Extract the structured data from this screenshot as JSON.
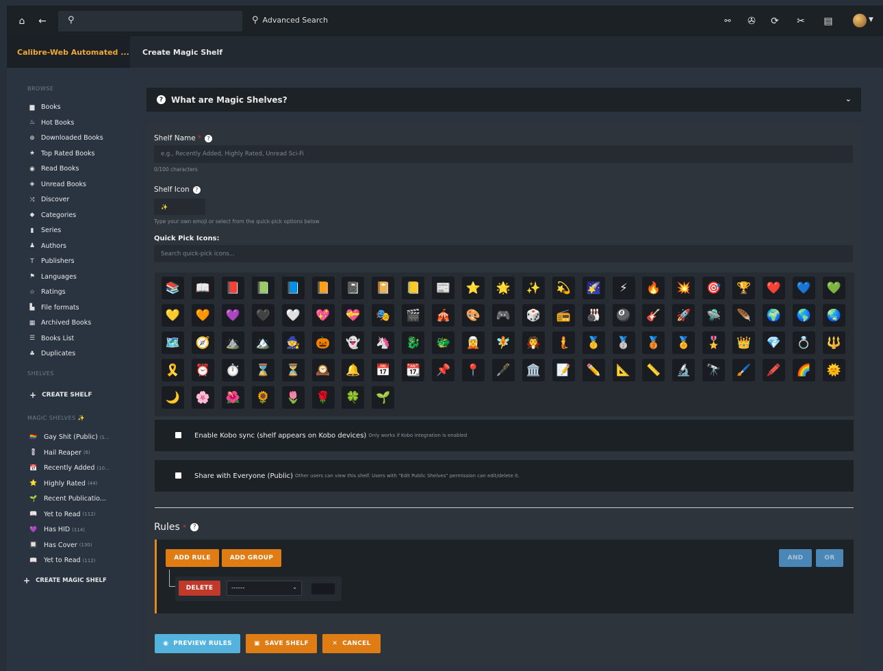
{
  "topbar": {
    "search_placeholder": "",
    "advanced_search": "Advanced Search"
  },
  "sidebar": {
    "brand": "Calibre-Web Automated ...",
    "browse_header": "BROWSE",
    "items": [
      {
        "icon": "book-icon",
        "glyph": "▆",
        "label": "Books"
      },
      {
        "icon": "fire-icon",
        "glyph": "♨",
        "label": "Hot Books"
      },
      {
        "icon": "download-icon",
        "glyph": "⊕",
        "label": "Downloaded Books"
      },
      {
        "icon": "star-icon",
        "glyph": "★",
        "label": "Top Rated Books"
      },
      {
        "icon": "eye-icon",
        "glyph": "◉",
        "label": "Read Books"
      },
      {
        "icon": "eye-slash-icon",
        "glyph": "◈",
        "label": "Unread Books"
      },
      {
        "icon": "shuffle-icon",
        "glyph": "⤨",
        "label": "Discover"
      },
      {
        "icon": "tags-icon",
        "glyph": "◆",
        "label": "Categories"
      },
      {
        "icon": "bookmark-icon",
        "glyph": "▮",
        "label": "Series"
      },
      {
        "icon": "user-icon",
        "glyph": "♟",
        "label": "Authors"
      },
      {
        "icon": "text-icon",
        "glyph": "T",
        "label": "Publishers"
      },
      {
        "icon": "flag-icon",
        "glyph": "⚑",
        "label": "Languages"
      },
      {
        "icon": "star-outline-icon",
        "glyph": "☆",
        "label": "Ratings"
      },
      {
        "icon": "file-icon",
        "glyph": "▙",
        "label": "File formats"
      },
      {
        "icon": "trash-icon",
        "glyph": "▦",
        "label": "Archived Books"
      },
      {
        "icon": "list-icon",
        "glyph": "☰",
        "label": "Books List"
      },
      {
        "icon": "users-icon",
        "glyph": "♣",
        "label": "Duplicates"
      }
    ],
    "shelves_header": "SHELVES",
    "create_shelf": "CREATE SHELF",
    "magic_header": "MAGIC SHELVES",
    "magic_items": [
      {
        "emoji": "🏳️‍🌈",
        "label": "Gay Shit (Public)",
        "count": "(1..."
      },
      {
        "emoji": "💈",
        "label": "Hail Reaper",
        "count": "(6)"
      },
      {
        "emoji": "📅",
        "label": "Recently Added",
        "count": "(10..."
      },
      {
        "emoji": "⭐",
        "label": "Highly Rated",
        "count": "(44)"
      },
      {
        "emoji": "🌱",
        "label": "Recent Publicatio...",
        "count": ""
      },
      {
        "emoji": "📖",
        "label": "Yet to Read",
        "count": "(112)"
      },
      {
        "emoji": "💜",
        "label": "Has HID",
        "count": "(114)"
      },
      {
        "emoji": "🔲",
        "label": "Has Cover",
        "count": "(130)"
      },
      {
        "emoji": "📖",
        "label": "Yet to Read",
        "count": "(112)"
      }
    ],
    "create_magic": "CREATE MAGIC SHELF"
  },
  "page": {
    "title": "Create Magic Shelf",
    "accordion": "What are Magic Shelves?",
    "shelf_name_label": "Shelf Name",
    "shelf_name_placeholder": "e.g., Recently Added, Highly Rated, Unread Sci-Fi",
    "char_count": "0/100 characters",
    "shelf_icon_label": "Shelf Icon",
    "shelf_icon_value": "✨",
    "icon_hint": "Type your own emoji or select from the quick-pick options below",
    "quick_pick_label": "Quick Pick Icons:",
    "quick_pick_placeholder": "Search quick-pick icons...",
    "icons": [
      "📚",
      "📖",
      "📕",
      "📗",
      "📘",
      "📙",
      "📓",
      "📔",
      "📒",
      "📰",
      "⭐",
      "🌟",
      "✨",
      "💫",
      "🌠",
      "⚡",
      "🔥",
      "💥",
      "🎯",
      "🏆",
      "❤️",
      "💙",
      "💚",
      "💛",
      "🧡",
      "💜",
      "🖤",
      "🤍",
      "💖",
      "💝",
      "🎭",
      "🎬",
      "🎪",
      "🎨",
      "🎮",
      "🎲",
      "📻",
      "🎳",
      "🎱",
      "🎸",
      "🚀",
      "🛸",
      "🪶",
      "🌍",
      "🌎",
      "🌏",
      "🗺️",
      "🧭",
      "⛰️",
      "🏔️",
      "🧙",
      "🎃",
      "👻",
      "🦄",
      "🐉",
      "🐲",
      "🧝",
      "🧚",
      "🧛",
      "🧜",
      "🥇",
      "🥈",
      "🥉",
      "🏅",
      "🎖️",
      "👑",
      "💎",
      "💍",
      "🔱",
      "🎗️",
      "⏰",
      "⏱️",
      "⌛",
      "⏳",
      "🕰️",
      "🔔",
      "📅",
      "📆",
      "📌",
      "📍",
      "🖋️",
      "🏛️",
      "📝",
      "✏️",
      "📐",
      "📏",
      "🔬",
      "🔭",
      "🖌️",
      "🖍️",
      "🌈",
      "🌞",
      "🌙",
      "🌸",
      "🌺",
      "🌻",
      "🌷",
      "🌹",
      "🍀",
      "🌱"
    ],
    "kobo_label": "Enable Kobo sync (shelf appears on Kobo devices)",
    "kobo_note": "Only works if Kobo integration is enabled",
    "public_label": "Share with Everyone (Public)",
    "public_note": "Other users can view this shelf. Users with \"Edit Public Shelves\" permission can edit/delete it.",
    "rules_label": "Rules",
    "add_rule": "ADD RULE",
    "add_group": "ADD GROUP",
    "and": "AND",
    "or": "OR",
    "delete": "DELETE",
    "select_value": "------",
    "preview": "PREVIEW RULES",
    "save": "SAVE SHELF",
    "cancel": "CANCEL"
  }
}
